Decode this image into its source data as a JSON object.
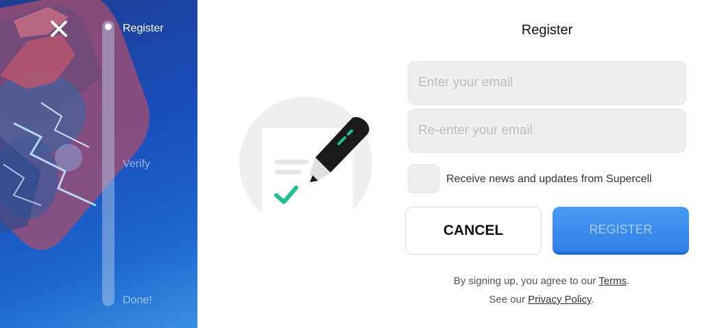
{
  "sidebar": {
    "close_icon": "close-icon",
    "steps": [
      {
        "label": "Register",
        "active": true
      },
      {
        "label": "Verify",
        "active": false
      },
      {
        "label": "Done!",
        "active": false
      }
    ]
  },
  "illustration": {
    "icon": "pen-document-check-icon"
  },
  "form": {
    "title": "Register",
    "email_placeholder": "Enter your email",
    "reenter_placeholder": "Re-enter your email",
    "email_value": "",
    "reenter_value": "",
    "newsletter_label": "Receive news and updates from Supercell",
    "newsletter_checked": false,
    "cancel_label": "CANCEL",
    "register_label": "REGISTER"
  },
  "legal": {
    "line1_prefix": "By signing up, you agree to our ",
    "terms_link": "Terms",
    "line1_suffix": ".",
    "line2_prefix": "See our ",
    "privacy_link": "Privacy Policy",
    "line2_suffix": "."
  },
  "colors": {
    "accent": "#2f7fe8",
    "sidebar_bg": "#1a4bb8",
    "check_green": "#1fbf95"
  }
}
